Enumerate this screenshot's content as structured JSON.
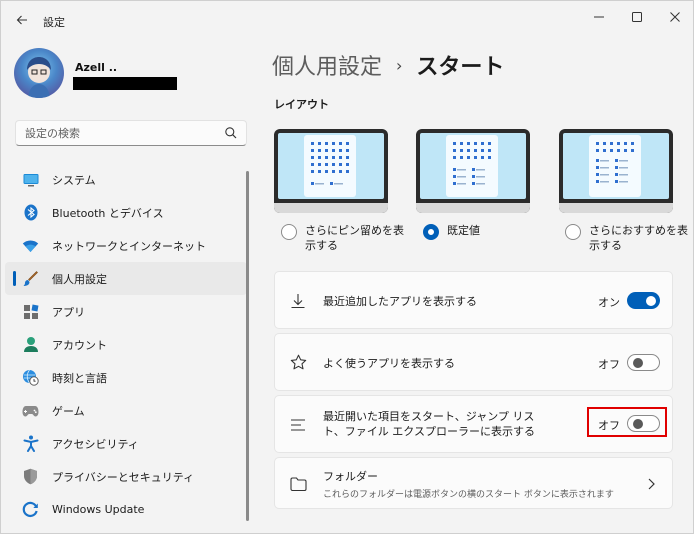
{
  "window": {
    "title": "設定",
    "back_icon": "back-arrow-icon",
    "controls": [
      "minimize-icon",
      "maximize-icon",
      "close-icon"
    ]
  },
  "user": {
    "name": "Azell .."
  },
  "search": {
    "placeholder": "設定の検索",
    "icon": "search-icon"
  },
  "sidebar": {
    "items": [
      {
        "label": "システム",
        "icon": "system-display-icon",
        "active": false
      },
      {
        "label": "Bluetooth とデバイス",
        "icon": "bluetooth-icon",
        "active": false
      },
      {
        "label": "ネットワークとインターネット",
        "icon": "wifi-icon",
        "active": false
      },
      {
        "label": "個人用設定",
        "icon": "paintbrush-icon",
        "active": true
      },
      {
        "label": "アプリ",
        "icon": "apps-icon",
        "active": false
      },
      {
        "label": "アカウント",
        "icon": "account-icon",
        "active": false
      },
      {
        "label": "時刻と言語",
        "icon": "globe-clock-icon",
        "active": false
      },
      {
        "label": "ゲーム",
        "icon": "gamepad-icon",
        "active": false
      },
      {
        "label": "アクセシビリティ",
        "icon": "accessibility-icon",
        "active": false
      },
      {
        "label": "プライバシーとセキュリティ",
        "icon": "shield-icon",
        "active": false
      },
      {
        "label": "Windows Update",
        "icon": "windows-update-icon",
        "active": false
      }
    ]
  },
  "main": {
    "breadcrumb_parent": "個人用設定",
    "breadcrumb_separator": "›",
    "breadcrumb_current": "スタート",
    "layout_section_title": "レイアウト",
    "layout_options": [
      {
        "label": "さらにピン留めを表\n示する",
        "checked": false,
        "variant": "more-pins"
      },
      {
        "label": "既定値",
        "checked": true,
        "variant": "default"
      },
      {
        "label": "さらにおすすめを表\n示する",
        "checked": false,
        "variant": "more-recommendations"
      }
    ],
    "settings": [
      {
        "label": "最近追加したアプリを表示する",
        "icon": "download-icon",
        "state_text": "オン",
        "on": true
      },
      {
        "label": "よく使うアプリを表示する",
        "icon": "star-icon",
        "state_text": "オフ",
        "on": false
      },
      {
        "label": "最近開いた項目をスタート、ジャンプ リス\nト、ファイル エクスプローラーに表示する",
        "icon": "list-lines-icon",
        "state_text": "オフ",
        "on": false
      }
    ],
    "folders": {
      "label": "フォルダー",
      "description": "これらのフォルダーは電源ボタンの横のスタート ボタンに表示されます",
      "icon": "folder-icon"
    }
  },
  "colors": {
    "accent": "#005fb8",
    "highlight": "#e00000"
  }
}
